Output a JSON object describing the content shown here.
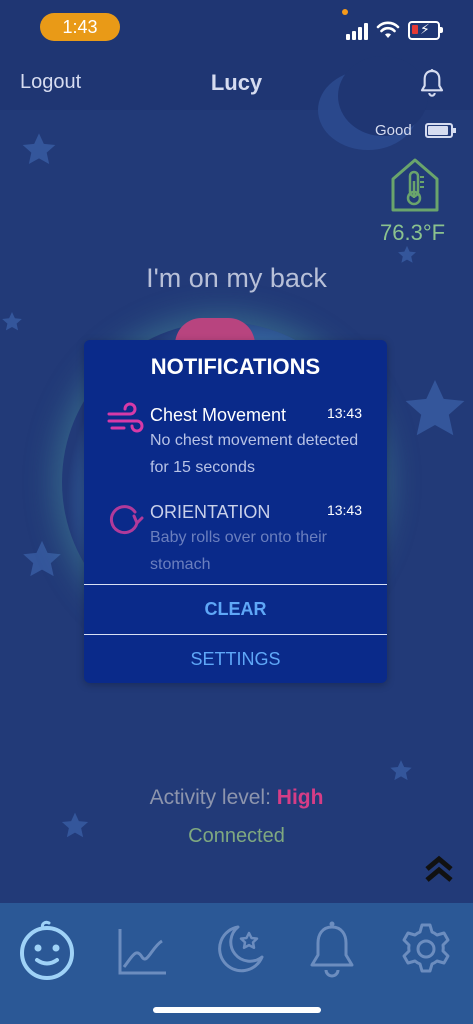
{
  "status_bar": {
    "time": "1:43",
    "battery_icon": "battery-charging-icon",
    "signal_icon": "cellular-signal-icon",
    "wifi_icon": "wifi-icon"
  },
  "header": {
    "logout_label": "Logout",
    "title": "Lucy",
    "bell_icon": "bell-icon"
  },
  "monitor": {
    "battery_label": "Good",
    "temperature": "76.3°F",
    "position_text": "I'm on my back",
    "activity_label": "Activity level:",
    "activity_value": "High",
    "connection_status": "Connected"
  },
  "notifications_modal": {
    "title": "NOTIFICATIONS",
    "items": [
      {
        "name": "Chest Movement",
        "time": "13:43",
        "description": "No chest movement detected for 15 seconds",
        "icon": "wind-icon",
        "read": false
      },
      {
        "name": "ORIENTATION",
        "time": "13:43",
        "description": "Baby rolls over onto their stomach",
        "icon": "rotate-icon",
        "read": true
      }
    ],
    "clear_label": "CLEAR",
    "settings_label": "SETTINGS"
  },
  "bottom_nav": {
    "items": [
      {
        "icon": "baby-face-icon",
        "active": true
      },
      {
        "icon": "line-chart-icon",
        "active": false
      },
      {
        "icon": "moon-star-icon",
        "active": false
      },
      {
        "icon": "bell-icon",
        "active": false
      },
      {
        "icon": "gear-icon",
        "active": false
      }
    ]
  },
  "colors": {
    "background": "#223a78",
    "modal": "#0a2a8a",
    "accent_blue": "#5fa7f7",
    "accent_pink": "#d63d86",
    "temperature_green": "#8bc28e",
    "nav_bar": "#2b5896"
  }
}
